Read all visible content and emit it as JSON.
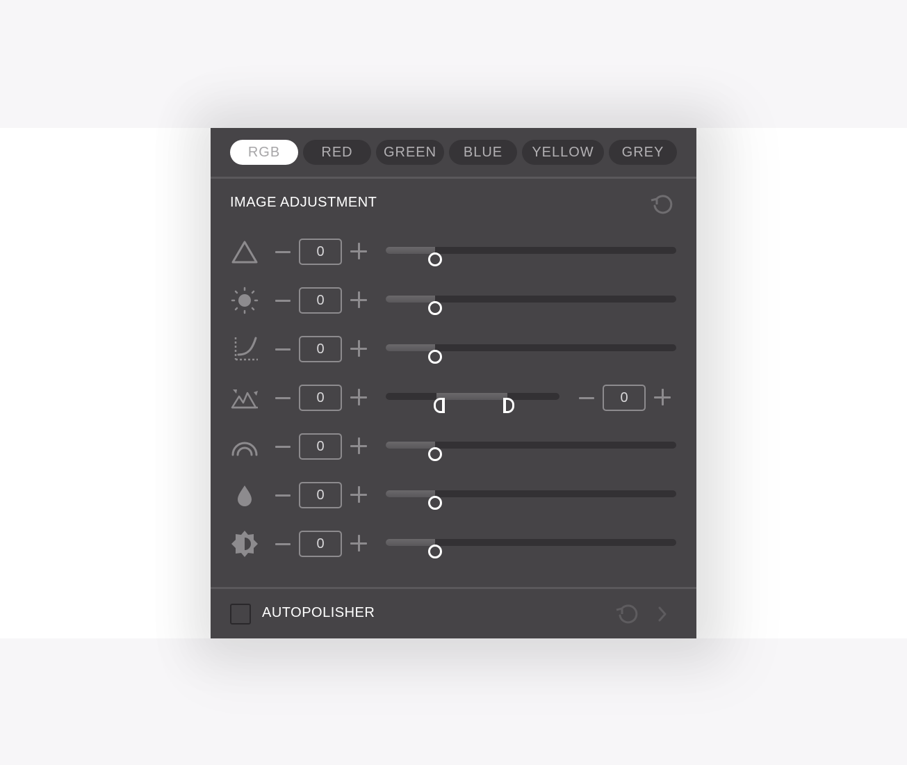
{
  "tabs": [
    {
      "label": "RGB",
      "active": true
    },
    {
      "label": "RED",
      "active": false
    },
    {
      "label": "GREEN",
      "active": false
    },
    {
      "label": "BLUE",
      "active": false
    },
    {
      "label": "YELLOW",
      "active": false
    },
    {
      "label": "GREY",
      "active": false
    }
  ],
  "section": {
    "title": "IMAGE ADJUSTMENT",
    "reset_icon": "reset-icon"
  },
  "rows": [
    {
      "icon": "triangle-icon",
      "value": "0",
      "slider": 0.17
    },
    {
      "icon": "brightness-sun-icon",
      "value": "0",
      "slider": 0.17
    },
    {
      "icon": "curve-icon",
      "value": "0",
      "slider": 0.17
    },
    {
      "icon": "levels-mountain-icon",
      "value": "0",
      "range": [
        0.29,
        0.7
      ],
      "value2": "0"
    },
    {
      "icon": "arc-icon",
      "value": "0",
      "slider": 0.17
    },
    {
      "icon": "drop-icon",
      "value": "0",
      "slider": 0.17
    },
    {
      "icon": "contrast-icon",
      "value": "0",
      "slider": 0.17
    }
  ],
  "footer": {
    "label": "AUTOPOLISHER",
    "checked": false,
    "reset_icon": "reset-icon",
    "chevron_icon": "chevron-right-icon"
  },
  "colors": {
    "panel": "#464447",
    "track": "#333134",
    "accent": "#ffffff",
    "control": "#8d8b8e"
  }
}
